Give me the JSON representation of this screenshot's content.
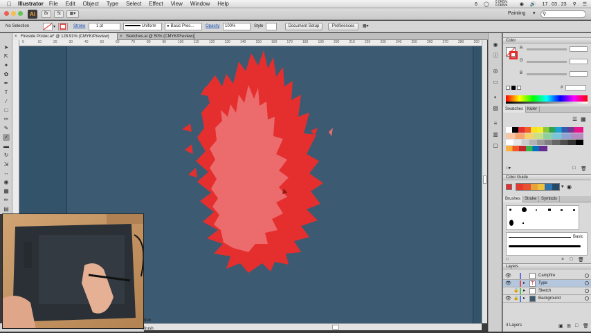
{
  "menubar": {
    "app_name": "Illustrator",
    "items": [
      "File",
      "Edit",
      "Object",
      "Type",
      "Select",
      "Effect",
      "View",
      "Window",
      "Help"
    ],
    "status": {
      "badge": "6",
      "battery_text": "0.0KB/s 0.0KB/s",
      "clock": "17 . 03 . 23"
    }
  },
  "appbar": {
    "logo": "Ai",
    "workspace": "Painting",
    "search_placeholder": "",
    "bridge_label": "Br",
    "stock_label": "St"
  },
  "controlbar": {
    "selection_label": "No Selection",
    "stroke_label": "Stroke",
    "stroke_weight": "1 pt",
    "profile": "Uniform",
    "brush": "Basic Pres...",
    "opacity_label": "Opacity",
    "opacity_value": "100%",
    "style_label": "Style",
    "document_setup": "Document Setup",
    "preferences": "Preferences"
  },
  "tabs": [
    {
      "label": "Fireside Poster.ai* @ 128.91% (CMYK/Preview)"
    },
    {
      "label": "Sketches.ai @ 50% (CMYK/Preview)"
    }
  ],
  "ruler": {
    "h_ticks": [
      "0",
      "10",
      "20",
      "30",
      "40",
      "50",
      "60",
      "70",
      "80",
      "90",
      "100",
      "110",
      "120",
      "130",
      "140",
      "150",
      "160",
      "170",
      "180",
      "190",
      "200",
      "210",
      "220",
      "230",
      "240",
      "250",
      "260",
      "270",
      "280",
      "290"
    ]
  },
  "statusbar": {
    "tool_text": "Blob Brush"
  },
  "panels": {
    "color": {
      "title": "Color",
      "channels": [
        {
          "label": "R"
        },
        {
          "label": "G"
        },
        {
          "label": "B"
        }
      ],
      "hex_prefix": "#"
    },
    "swatches": {
      "tabs": [
        "Swatches",
        "Kuler"
      ]
    },
    "color_guide": {
      "title": "Color Guide",
      "colors": [
        "#e8392e",
        "#e85030",
        "#e8a23a",
        "#f0c23c",
        "#2e72b0",
        "#24486a"
      ]
    },
    "brushes": {
      "tabs": [
        "Brushes",
        "Stroke",
        "Symbols"
      ],
      "basic_label": "Basic"
    },
    "layers": {
      "title": "Layers",
      "items": [
        {
          "name": "Campfire",
          "color": "#6a6adb",
          "selected": false
        },
        {
          "name": "Type",
          "color": "#e94a4a",
          "selected": true
        },
        {
          "name": "Sketch",
          "color": "#4fc24f",
          "selected": false
        },
        {
          "name": "Background",
          "color": "#4a7fd9",
          "selected": false
        }
      ],
      "count": "4 Layers"
    }
  },
  "colors": {
    "canvas": "#33536a",
    "flame_outer": "#e42f2e",
    "flame_inner": "#ec6b6c",
    "accent_selection": "#b5c7df"
  }
}
